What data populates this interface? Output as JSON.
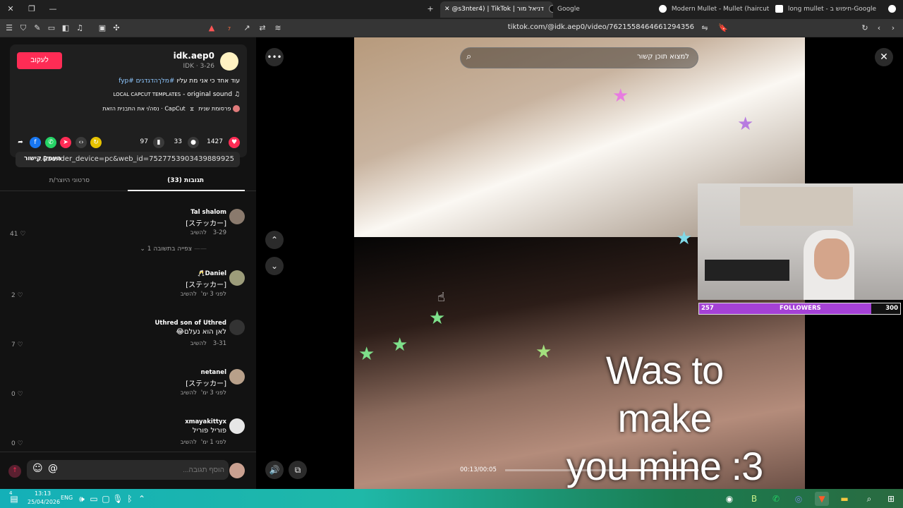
{
  "browser": {
    "tabs": [
      {
        "label": "Google"
      },
      {
        "label": "@s3nter4) | TikTok | דניאל מור"
      },
      {
        "label": "Modern Mullet - Mullet (haircut) - W"
      },
      {
        "label": "long mullet - חיפוש ב-Google"
      }
    ],
    "url": "tiktok.com/@idk.aep0/video/7621558464661294356",
    "new_tab": "+",
    "shield_badge": "7"
  },
  "post": {
    "username": "idk.aep0",
    "sub": "IDK · 3-26",
    "follow_label": "לעקוב",
    "caption_plain": "עוד אחד כי אני מת עליו ",
    "caption_tags": "#מלךהדגדגים #fyp",
    "sound_name": "original sound",
    "sound_author": "LOCAL CAPCUT TEMPLATES",
    "sponsor_line1": "פרסומת שנית",
    "sponsor_line2": "CapCut · נסה/י את התבנית הזאת",
    "likes": "1427",
    "comments_count": "33",
    "saves": "97",
    "share_link": "...&sender_device=pc&web_id=7527753903439889925",
    "copy_label": "העתק קישור"
  },
  "panel_tabs": {
    "comments": "תגובות (33)",
    "creator_videos": "סרטוני היוצר/ת"
  },
  "comments": [
    {
      "user": "Tal shalom",
      "text": "[ステッカー]",
      "date": "3-29",
      "reply": "להשיב",
      "likes": "41"
    },
    {
      "user": "Daniel🥂",
      "text": "[ステッカー]",
      "date": "לפני 3 ימ'",
      "reply": "להשיב",
      "likes": "2"
    },
    {
      "user": "Uthred son of Uthred",
      "text": "לאן הוא נעלם😂",
      "date": "3-31",
      "reply": "להשיב",
      "likes": "7"
    },
    {
      "user": "netanel",
      "text": "[ステッカー]",
      "date": "לפני 3 ימ'",
      "reply": "להשיב",
      "likes": "0"
    },
    {
      "user": "xmayakittyx",
      "text": "פוריל פוריל",
      "date": "לפני 1 ימ'",
      "reply": "להשיב",
      "likes": "0"
    }
  ],
  "view_replies": "צפייה בתשובה 1",
  "composer": {
    "placeholder": "הוסף תגובה..."
  },
  "video": {
    "search_placeholder": "למצוא תוכן קשור",
    "overlay_line1": "Was to make",
    "overlay_line2": "you mine :3",
    "time": "00:13/00:05",
    "progress": 0.45
  },
  "webcam": {
    "followers_current": "257",
    "followers_label": "FOLLOWERS",
    "followers_goal": "300",
    "fill": 0.8567
  },
  "taskbar": {
    "time": "13:13",
    "date": "25/04/2026",
    "lang": "ENG",
    "counter": "4"
  },
  "colors": {
    "accent": "#fe2c55",
    "hashtag": "#8ec7ff",
    "follower_bar": "#a541d6"
  }
}
